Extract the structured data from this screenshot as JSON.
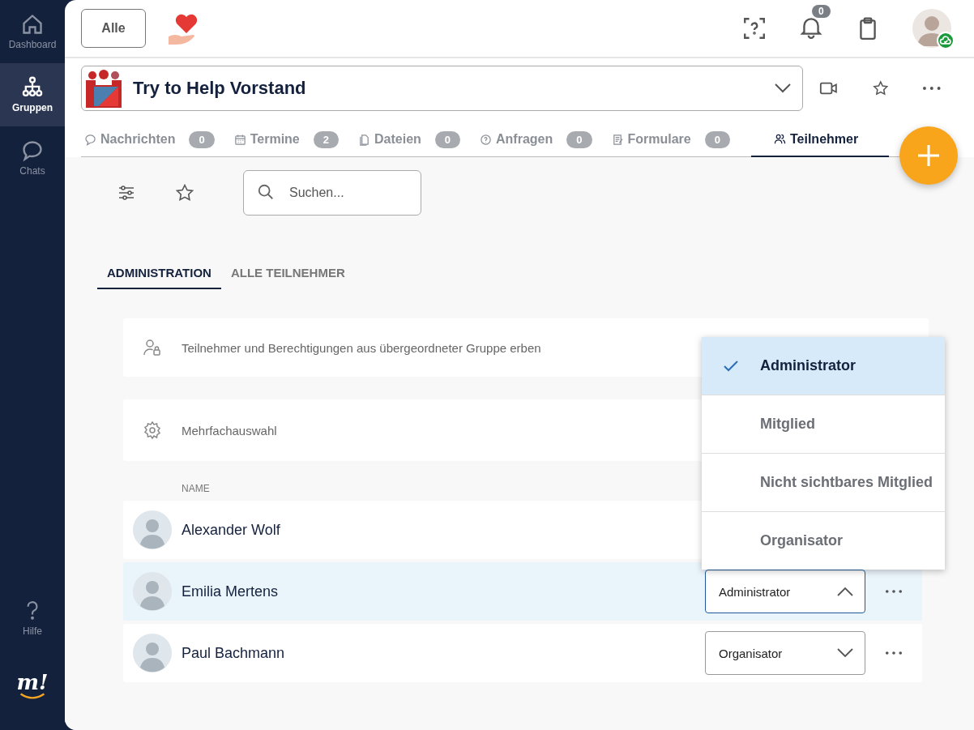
{
  "sidebar": {
    "items": [
      {
        "label": "Dashboard",
        "kind": "home",
        "selected": false
      },
      {
        "label": "Gruppen",
        "kind": "groups",
        "selected": true
      },
      {
        "label": "Chats",
        "kind": "chat",
        "selected": false
      }
    ],
    "help": {
      "label": "Hilfe"
    },
    "logo": "m!"
  },
  "header": {
    "filter_button": "Alle",
    "notification_count": "0"
  },
  "group": {
    "name": "Try to Help Vorstand"
  },
  "tabs": [
    {
      "label": "Nachrichten",
      "count": "0",
      "kind": "chat",
      "selected": false
    },
    {
      "label": "Termine",
      "count": "2",
      "kind": "calendar",
      "selected": false
    },
    {
      "label": "Dateien",
      "count": "0",
      "kind": "files",
      "selected": false
    },
    {
      "label": "Anfragen",
      "count": "0",
      "kind": "question",
      "selected": false
    },
    {
      "label": "Formulare",
      "count": "0",
      "kind": "form",
      "selected": false
    },
    {
      "label": "Teilnehmer",
      "kind": "people",
      "selected": true
    }
  ],
  "search": {
    "placeholder": "Suchen..."
  },
  "subtabs": [
    {
      "label": "ADMINISTRATION",
      "selected": true
    },
    {
      "label": "ALLE TEILNEHMER",
      "selected": false
    }
  ],
  "settings": [
    {
      "label": "Teilnehmer und Berechtigungen aus übergeordneter Gruppe erben",
      "kind": "inherit"
    },
    {
      "label": "Mehrfachauswahl",
      "kind": "multiselect"
    }
  ],
  "table": {
    "columns": [
      "NAME"
    ],
    "rows": [
      {
        "name": "Alexander Wolf",
        "selected": false
      },
      {
        "name": "Emilia Mertens",
        "selected": true,
        "role": "Administrator",
        "expanded": true
      },
      {
        "name": "Paul Bachmann",
        "selected": false,
        "role": "Organisator",
        "expanded": false
      }
    ]
  },
  "role_menu": {
    "options": [
      {
        "label": "Administrator",
        "selected": true
      },
      {
        "label": "Mitglied",
        "selected": false
      },
      {
        "label": "Nicht sichtbares Mitglied",
        "selected": false
      },
      {
        "label": "Organisator",
        "selected": false
      }
    ]
  }
}
